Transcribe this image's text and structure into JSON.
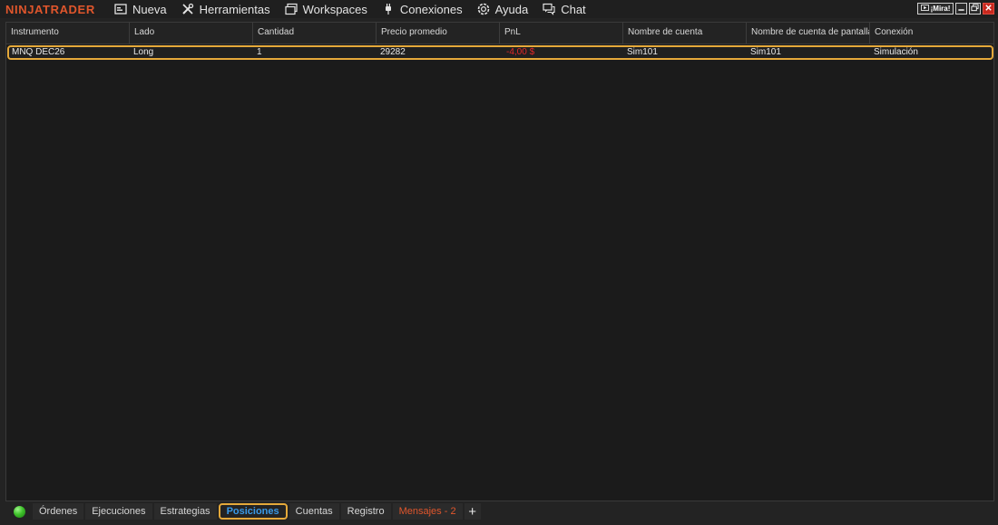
{
  "app": {
    "logo_text": "NINJATRADER"
  },
  "menu": [
    {
      "label": "Nueva",
      "icon": "new-window-icon"
    },
    {
      "label": "Herramientas",
      "icon": "tools-icon"
    },
    {
      "label": "Workspaces",
      "icon": "workspaces-icon"
    },
    {
      "label": "Conexiones",
      "icon": "plug-icon"
    },
    {
      "label": "Ayuda",
      "icon": "lifebuoy-icon"
    },
    {
      "label": "Chat",
      "icon": "chat-icon"
    }
  ],
  "window_controls": {
    "watch_label": "¡Mira!",
    "watch_icon": "play-icon",
    "minimize_icon": "minimize-icon",
    "restore_icon": "restore-icon",
    "close_icon": "close-icon"
  },
  "grid": {
    "columns": [
      "Instrumento",
      "Lado",
      "Cantidad",
      "Precio promedio",
      "PnL",
      "Nombre de cuenta",
      "Nombre de cuenta de pantalla",
      "Conexión"
    ],
    "rows": [
      [
        "MNQ DEC26",
        "Long",
        "1",
        "29282",
        "-4,00 $",
        "Sim101",
        "Sim101",
        "Simulación"
      ]
    ]
  },
  "tabs": [
    {
      "label": "Órdenes",
      "active": false
    },
    {
      "label": "Ejecuciones",
      "active": false
    },
    {
      "label": "Estrategias",
      "active": false
    },
    {
      "label": "Posiciones",
      "active": true
    },
    {
      "label": "Cuentas",
      "active": false
    },
    {
      "label": "Registro",
      "active": false
    },
    {
      "label": "Mensajes - 2",
      "active": false,
      "alert": true
    }
  ],
  "colors": {
    "accent_orange": "#e0562c",
    "highlight_border": "#e5a93a",
    "active_tab_text": "#3a9ae8",
    "negative_pnl": "#e22828",
    "status_green": "#3fc22b"
  }
}
